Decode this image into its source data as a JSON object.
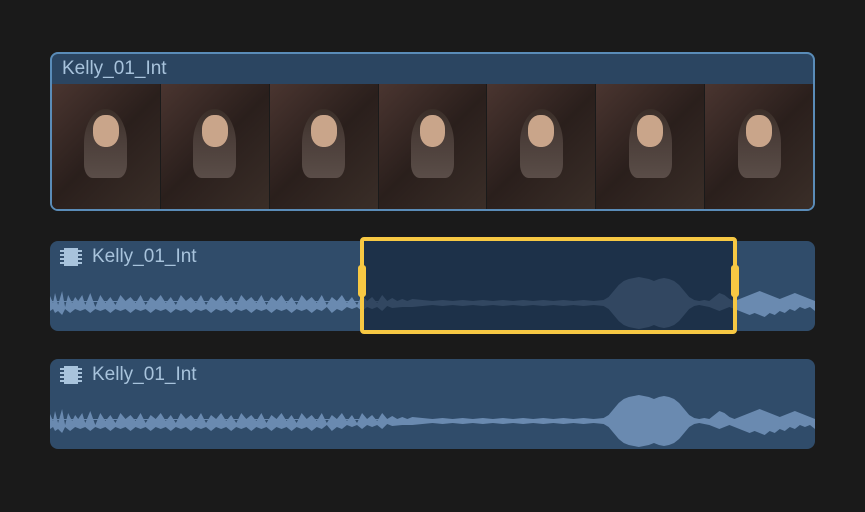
{
  "video_clip": {
    "name": "Kelly_01_Int",
    "frame_count": 7
  },
  "audio_clips": [
    {
      "name": "Kelly_01_Int",
      "has_selection": true,
      "selection": {
        "start_pct": 40.5,
        "end_pct": 89.8
      }
    },
    {
      "name": "Kelly_01_Int",
      "has_selection": false
    }
  ]
}
